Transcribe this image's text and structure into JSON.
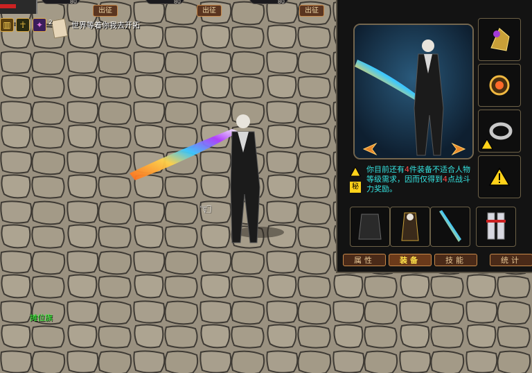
{
  "hud": {
    "party_levels": [
      "80",
      "80",
      "80"
    ],
    "sortie_buttons": [
      "出征",
      "出征",
      "出征"
    ],
    "buff_count": "2",
    "status_text": "世界等着你我去开拓",
    "stall_label": "摊位旗",
    "hp_fraction": 0.45
  },
  "equipment": {
    "notice": {
      "p1": "你目前还有",
      "count": "4",
      "p2": "件装备不适合人物等级需求，因而仅得到",
      "points": "4",
      "p3": "点战斗力奖励。"
    },
    "notice_badge": "秘",
    "tabs": [
      {
        "label": "属性",
        "active": false
      },
      {
        "label": "装备",
        "active": true
      },
      {
        "label": "技能",
        "active": false
      },
      {
        "label": "统计",
        "active": false
      }
    ],
    "right_slots": [
      "helmet-icon",
      "amulet-icon",
      "bracelet-icon",
      "warning-icon"
    ],
    "bottom_slots": [
      "armor-icon",
      "belt-icon",
      "sword-icon",
      "boots-icon"
    ]
  }
}
